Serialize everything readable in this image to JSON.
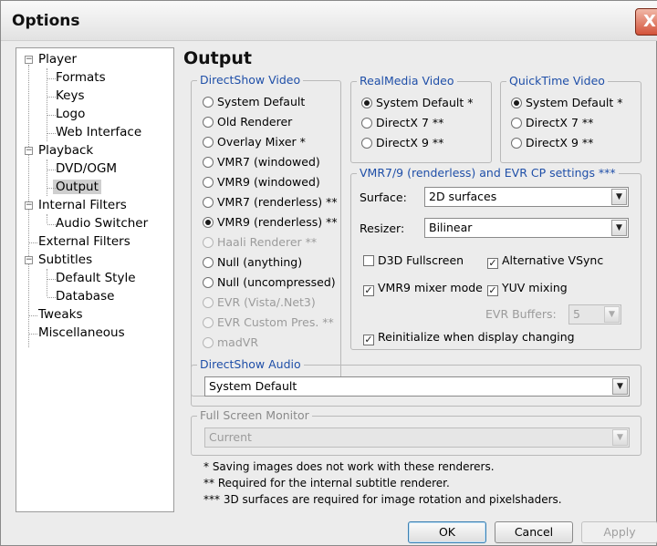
{
  "window": {
    "title": "Options",
    "close_glyph": "X"
  },
  "tree": {
    "items": [
      {
        "label": "Player",
        "expander": "−"
      },
      {
        "label": "Formats"
      },
      {
        "label": "Keys"
      },
      {
        "label": "Logo"
      },
      {
        "label": "Web Interface"
      },
      {
        "label": "Playback",
        "expander": "−"
      },
      {
        "label": "DVD/OGM"
      },
      {
        "label": "Output",
        "selected": true
      },
      {
        "label": "Internal Filters",
        "expander": "−"
      },
      {
        "label": "Audio Switcher"
      },
      {
        "label": "External Filters"
      },
      {
        "label": "Subtitles",
        "expander": "−"
      },
      {
        "label": "Default Style"
      },
      {
        "label": "Database"
      },
      {
        "label": "Tweaks"
      },
      {
        "label": "Miscellaneous"
      }
    ]
  },
  "page_title": "Output",
  "directshow_video": {
    "label": "DirectShow Video",
    "options": [
      {
        "label": "System Default",
        "checked": false,
        "enabled": true
      },
      {
        "label": "Old Renderer",
        "checked": false,
        "enabled": true
      },
      {
        "label": "Overlay Mixer *",
        "checked": false,
        "enabled": true
      },
      {
        "label": "VMR7 (windowed)",
        "checked": false,
        "enabled": true
      },
      {
        "label": "VMR9 (windowed)",
        "checked": false,
        "enabled": true
      },
      {
        "label": "VMR7 (renderless) **",
        "checked": false,
        "enabled": true
      },
      {
        "label": "VMR9 (renderless) **",
        "checked": true,
        "enabled": true
      },
      {
        "label": "Haali Renderer **",
        "checked": false,
        "enabled": false
      },
      {
        "label": "Null (anything)",
        "checked": false,
        "enabled": true
      },
      {
        "label": "Null (uncompressed)",
        "checked": false,
        "enabled": true
      },
      {
        "label": "EVR (Vista/.Net3)",
        "checked": false,
        "enabled": false
      },
      {
        "label": "EVR Custom Pres. **",
        "checked": false,
        "enabled": false
      },
      {
        "label": "madVR",
        "checked": false,
        "enabled": false
      }
    ]
  },
  "realmedia_video": {
    "label": "RealMedia Video",
    "options": [
      {
        "label": "System Default *",
        "checked": true
      },
      {
        "label": "DirectX 7 **",
        "checked": false
      },
      {
        "label": "DirectX 9 **",
        "checked": false
      }
    ]
  },
  "quicktime_video": {
    "label": "QuickTime Video",
    "options": [
      {
        "label": "System Default *",
        "checked": true
      },
      {
        "label": "DirectX 7 **",
        "checked": false
      },
      {
        "label": "DirectX 9 **",
        "checked": false
      }
    ]
  },
  "vmr_settings": {
    "label": "VMR7/9 (renderless) and EVR CP settings ***",
    "surface_label": "Surface:",
    "surface_value": "2D surfaces",
    "resizer_label": "Resizer:",
    "resizer_value": "Bilinear",
    "d3d_fullscreen": {
      "label": "D3D Fullscreen",
      "checked": false
    },
    "alternative_vsync": {
      "label": "Alternative VSync",
      "checked": true
    },
    "vmr9_mixer_mode": {
      "label": "VMR9 mixer mode",
      "checked": true
    },
    "yuv_mixing": {
      "label": "YUV mixing",
      "checked": true
    },
    "evr_buffers_label": "EVR Buffers:",
    "evr_buffers_value": "5",
    "reinitialize": {
      "label": "Reinitialize when display changing",
      "checked": true
    }
  },
  "directshow_audio": {
    "label": "DirectShow Audio",
    "value": "System Default"
  },
  "fullscreen_monitor": {
    "label": "Full Screen Monitor",
    "value": "Current"
  },
  "notes": [
    "* Saving images does not work with these renderers.",
    "** Required for the internal subtitle renderer.",
    "*** 3D surfaces are required for image rotation and pixelshaders."
  ],
  "buttons": {
    "ok": "OK",
    "cancel": "Cancel",
    "apply": "Apply"
  },
  "glyphs": {
    "check": "✓",
    "dropdown": "▼"
  }
}
